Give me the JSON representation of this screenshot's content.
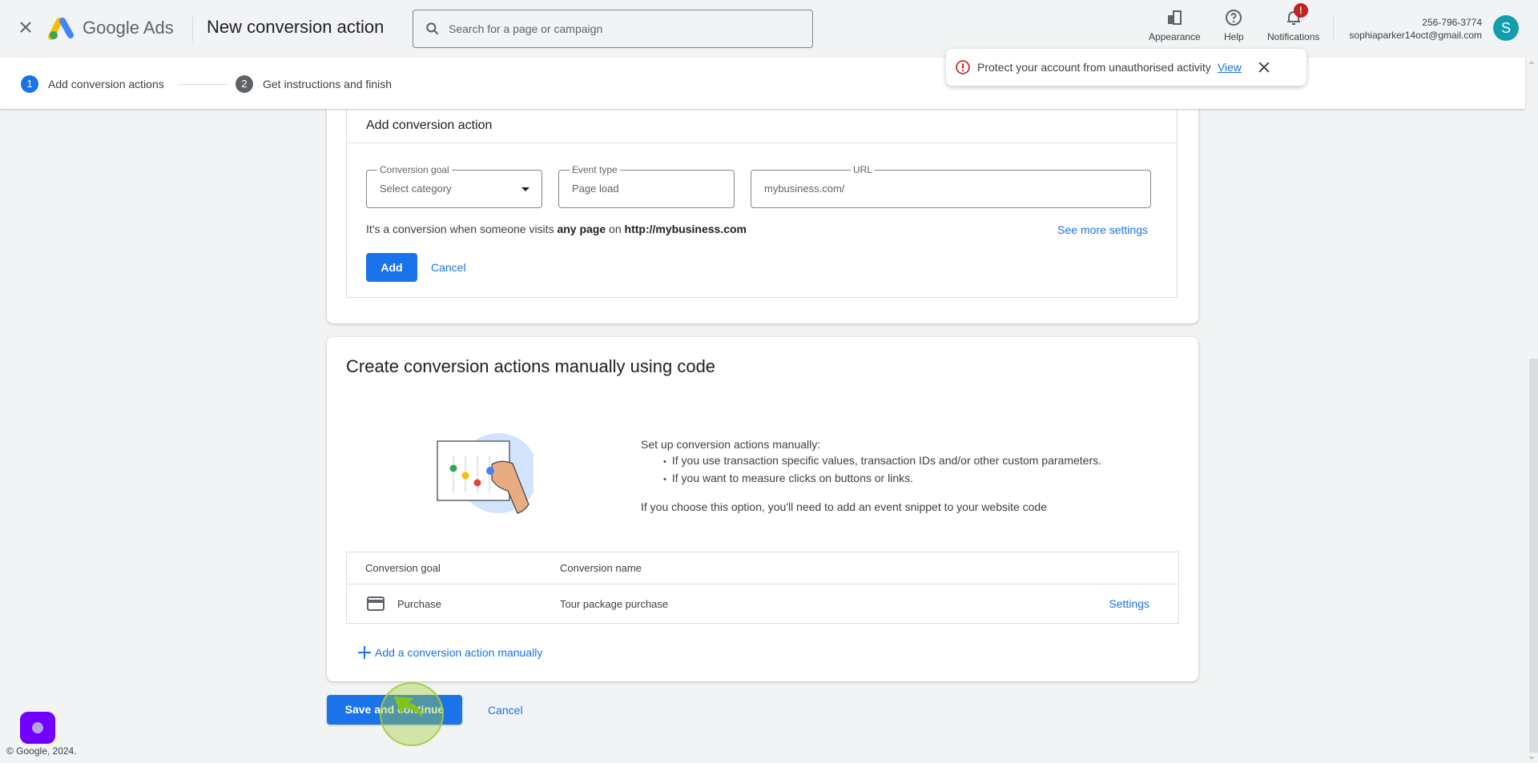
{
  "header": {
    "close_icon": "close-icon",
    "brand": "Google Ads",
    "title": "New conversion action",
    "search_placeholder": "Search for a page or campaign",
    "tools": [
      {
        "label": "Appearance",
        "icon": "appearance-icon"
      },
      {
        "label": "Help",
        "icon": "help-icon"
      },
      {
        "label": "Notifications",
        "icon": "bell-icon",
        "badge": "!"
      }
    ],
    "account": {
      "phone": "256-796-3774",
      "email": "sophiaparker14oct@gmail.com",
      "avatar_letter": "S"
    }
  },
  "stepper": {
    "steps": [
      {
        "num": "1",
        "label": "Add conversion actions",
        "active": true
      },
      {
        "num": "2",
        "label": "Get instructions and finish",
        "active": false
      }
    ]
  },
  "toast": {
    "message": "Protect your account from unauthorised activity",
    "link": "View"
  },
  "add_card": {
    "title": "Add conversion action",
    "fields": {
      "goal": {
        "label": "Conversion goal",
        "value": "Select category"
      },
      "event": {
        "label": "Event type",
        "value": "Page load"
      },
      "url": {
        "label": "URL",
        "value": "mybusiness.com/"
      }
    },
    "desc_prefix": "It's a conversion when someone visits ",
    "desc_bold1": "any page",
    "desc_mid": " on ",
    "desc_bold2": "http://mybusiness.com",
    "see_more": "See more settings",
    "add_label": "Add",
    "cancel_label": "Cancel"
  },
  "manual_card": {
    "title": "Create conversion actions manually using code",
    "intro": "Set up conversion actions manually:",
    "bullets": [
      "If you use transaction specific values, transaction IDs and/or other custom parameters.",
      "If you want to measure clicks on buttons or links."
    ],
    "note": "If you choose this option, you'll need to add an event snippet to your website code",
    "table": {
      "headers": [
        "Conversion goal",
        "Conversion name"
      ],
      "rows": [
        {
          "goal": "Purchase",
          "name": "Tour package purchase",
          "action": "Settings",
          "icon": "credit-card-icon"
        }
      ]
    },
    "add_manual": "Add a conversion action manually"
  },
  "footer": {
    "save_label": "Save and continue",
    "cancel_label": "Cancel",
    "copyright": "© Google, 2024."
  },
  "colors": {
    "accent": "#1a73e8",
    "error": "#c5221f",
    "avatar": "#129eaf",
    "background": "#f1f3f4"
  }
}
